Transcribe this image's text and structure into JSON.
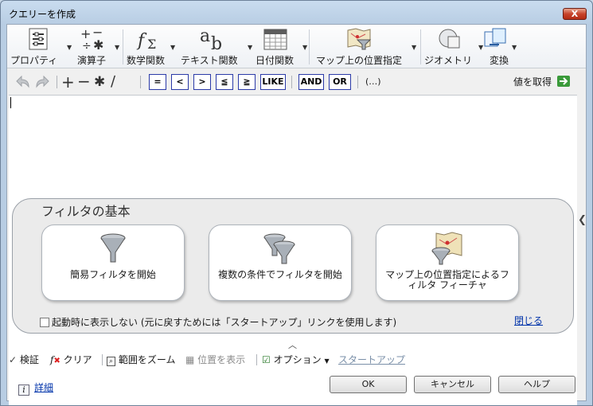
{
  "window": {
    "title": "クエリーを作成",
    "close_glyph": "X"
  },
  "ribbon": {
    "properties": "プロパティ",
    "operators": "演算子",
    "math": "数学関数",
    "text": "テキスト関数",
    "date": "日付関数",
    "map": "マップ上の位置指定",
    "geometry": "ジオメトリ",
    "convert": "変換"
  },
  "toolbar": {
    "eq": "=",
    "lt": "<",
    "gt": ">",
    "le": "≦",
    "ge": "≧",
    "like": "LIKE",
    "and": "AND",
    "or": "OR",
    "paren": "(…)",
    "get_value": "値を取得"
  },
  "filter_panel": {
    "title": "フィルタの基本",
    "cards": [
      {
        "label": "簡易フィルタを開始"
      },
      {
        "label": "複数の条件でフィルタを開始"
      },
      {
        "label": "マップ上の位置指定によるフィルタ フィーチャ"
      }
    ],
    "startup_checkbox": "起動時に表示しない (元に戻すためには「スタートアップ」リンクを使用します)",
    "close_link": "閉じる"
  },
  "bottombar": {
    "verify": "検証",
    "clear": "クリア",
    "zoom": "範囲をズーム",
    "show_location": "位置を表示",
    "options": "オプション",
    "startup": "スタートアップ"
  },
  "buttons": {
    "ok": "OK",
    "cancel": "キャンセル",
    "help": "ヘルプ"
  },
  "details": "詳細"
}
